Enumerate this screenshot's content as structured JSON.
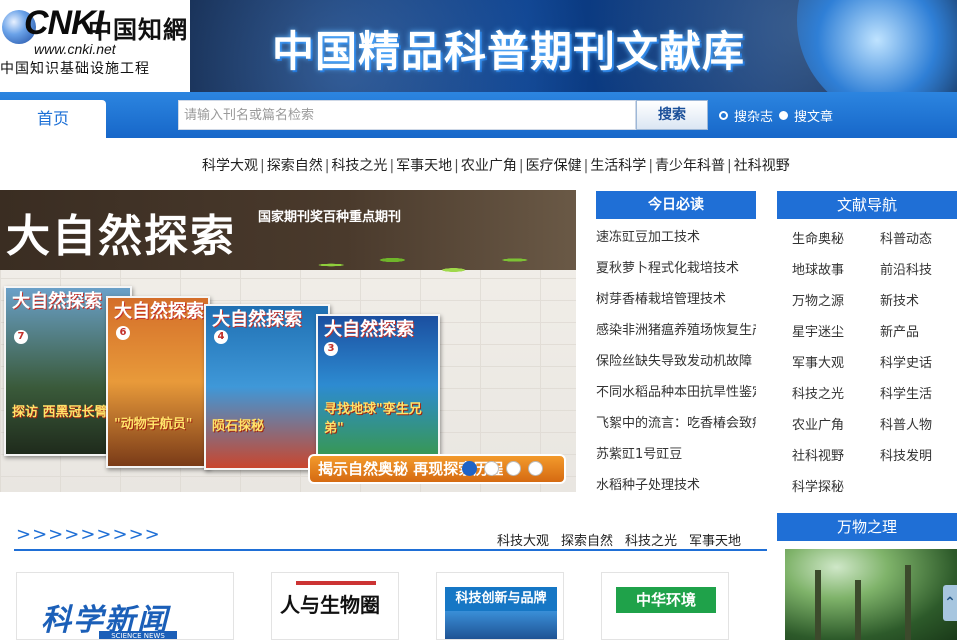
{
  "header": {
    "logo_cnki": "CNKI",
    "logo_cn": "中国知網",
    "logo_url": "www.cnki.net",
    "logo_sub": "中国知识基础设施工程",
    "title": "中国精品科普期刊文献库"
  },
  "nav": {
    "home_tab": "首页",
    "search_placeholder": "请输入刊名或篇名检索",
    "search_button": "搜索",
    "radio_options": [
      {
        "label": "搜杂志",
        "selected": false
      },
      {
        "label": "搜文章",
        "selected": true
      }
    ]
  },
  "categories": [
    "科学大观",
    "探索自然",
    "科技之光",
    "军事天地",
    "农业广角",
    "医疗保健",
    "生活科学",
    "青少年科普",
    "社科视野"
  ],
  "hero": {
    "title": "大自然探索",
    "subtitle": "国家期刊奖百种重点期刊",
    "magazines": [
      {
        "name": "大自然探索",
        "num": "7",
        "tag": "探访 西黑冠长臂猿"
      },
      {
        "name": "大自然探索",
        "num": "6",
        "tag": "\"动物宇航员\""
      },
      {
        "name": "大自然探索",
        "num": "4",
        "tag": "陨石探秘"
      },
      {
        "name": "大自然探索",
        "num": "3",
        "tag": "寻找地球\"孪生兄弟\""
      }
    ],
    "banner_text": "揭示自然奥秘  再现探索历程",
    "dots": 4,
    "active_dot": 0
  },
  "today": {
    "heading": "今日必读",
    "items": [
      "速冻豇豆加工技术",
      "夏秋萝卜程式化栽培技术",
      "树芽香椿栽培管理技术",
      "感染非洲猪瘟养殖场恢复生产",
      "保险丝缺失导致发动机故障",
      "不同水稻品种本田抗旱性鉴定",
      "飞絮中的流言：吃香椿会致癌",
      "苏紫豇1号豇豆",
      "水稻种子处理技术"
    ]
  },
  "literature_nav": {
    "heading": "文献导航",
    "items": [
      "生命奥秘",
      "科普动态",
      "地球故事",
      "前沿科技",
      "万物之源",
      "新技术",
      "星宇迷尘",
      "新产品",
      "军事大观",
      "科学史话",
      "科技之光",
      "科学生活",
      "农业广角",
      "科普人物",
      "社科视野",
      "科技发明",
      "科学探秘"
    ]
  },
  "wanwu": {
    "heading": "万物之理"
  },
  "bottom": {
    "more": ">>>>>>>>>",
    "tabs": [
      "科技大观",
      "探索自然",
      "科技之光",
      "军事天地"
    ],
    "thumbs": [
      {
        "title": "科学新闻",
        "sub": "SCIENCE NEWS"
      },
      {
        "title": "人与生物圈"
      },
      {
        "title": "科技创新与品牌"
      },
      {
        "title": "中华环境"
      }
    ]
  },
  "scroll_top_label": "⌃",
  "colors": {
    "accent": "#1f6fd6",
    "nav_bg": "#1767c9",
    "hero_banner": "#e07a1a"
  }
}
